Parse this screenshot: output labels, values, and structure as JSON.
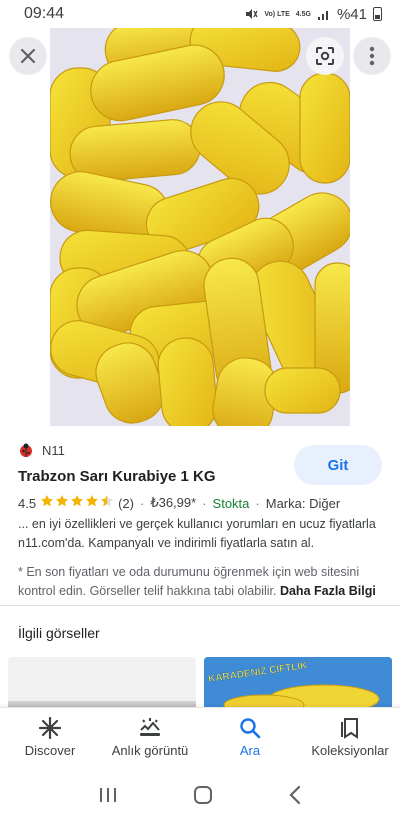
{
  "status_bar": {
    "time": "09:44",
    "network": "Vo) LTE",
    "signal_label": "4.5G",
    "battery": "%41"
  },
  "source": {
    "name": "N11"
  },
  "product": {
    "title": "Trabzon Sarı Kurabiye 1 KG",
    "rating": "4.5",
    "stars_filled": 4.5,
    "review_count": "(2)",
    "price": "₺36,99*",
    "stock": "Stokta",
    "brand": "Marka: Diğer",
    "description": "... en iyi özellikleri ve gerçek kullanıcı yorumları en ucuz fiyatlarla n11.com'da. Kampanyalı ve indirimli fiyatlarla satın al.",
    "note": "* En son fiyatları ve oda durumunu öğrenmek için web sitesini kontrol edin. Görseller telif hakkına tabi olabilir.",
    "note_link": "Daha Fazla Bilgi"
  },
  "visit_button": "Git",
  "related": {
    "title": "İlgili görseller",
    "thumb2_label": "KARADENİZ ÇİFTLİK"
  },
  "bottom_nav": [
    {
      "label": "Discover",
      "icon": "asterisk-icon"
    },
    {
      "label": "Anlık görüntü",
      "icon": "snapshot-icon"
    },
    {
      "label": "Ara",
      "icon": "search-icon"
    },
    {
      "label": "Koleksiyonlar",
      "icon": "collections-icon"
    }
  ],
  "colors": {
    "accent": "#1a73e8",
    "stock": "#188038",
    "star": "#f4b400",
    "git_bg": "#e8f0fe"
  }
}
